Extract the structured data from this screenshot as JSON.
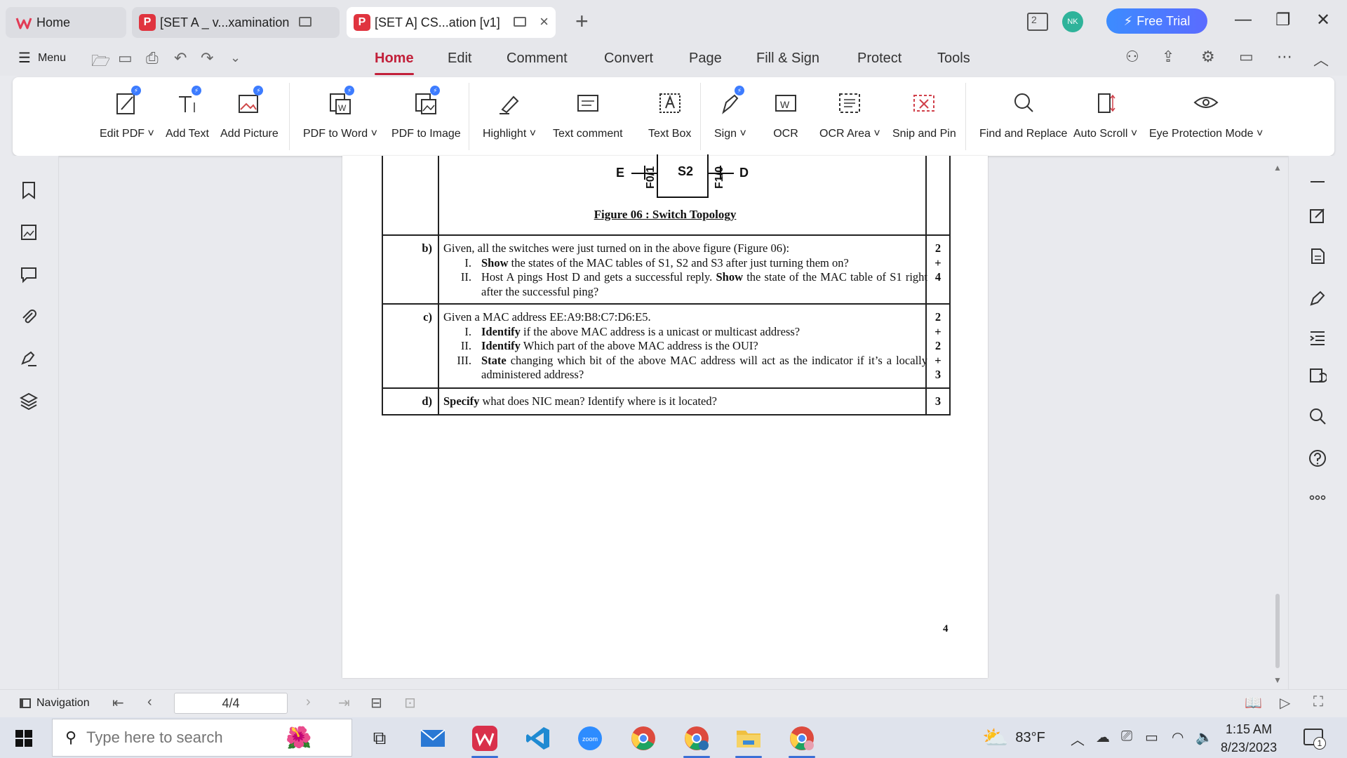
{
  "tabs": [
    {
      "label": "Home"
    },
    {
      "label": "[SET A _ v...xamination"
    },
    {
      "label": "[SET A] CS...ation [v1]"
    }
  ],
  "header": {
    "account_initials": "NK",
    "free_trial_label": "Free Trial",
    "window_count": "2"
  },
  "menubar": {
    "menu_label": "Menu",
    "tabs": [
      "Home",
      "Edit",
      "Comment",
      "Convert",
      "Page",
      "Fill & Sign",
      "Protect",
      "Tools"
    ],
    "active_tab": "Home"
  },
  "ribbon": {
    "edit_pdf": "Edit PDF",
    "add_text": "Add Text",
    "add_picture": "Add Picture",
    "pdf_to_word": "PDF to Word",
    "pdf_to_image": "PDF to Image",
    "highlight": "Highlight",
    "text_comment": "Text comment",
    "text_box": "Text Box",
    "sign": "Sign",
    "ocr": "OCR",
    "ocr_area": "OCR Area",
    "snip_and_pin": "Snip and Pin",
    "find_and_replace": "Find and Replace",
    "auto_scroll": "Auto Scroll",
    "eye_protection": "Eye Protection Mode"
  },
  "document": {
    "topology": {
      "node_left": "E",
      "switch": "S2",
      "node_right": "D",
      "port_left": "F0/1",
      "port_right": "F1/0",
      "caption": "Figure 06 : Switch Topology"
    },
    "questions": [
      {
        "letter": "b)",
        "intro": "Given, all the switches were just turned on in the above figure (Figure 06):",
        "subs": [
          {
            "num": "I.",
            "bold": "Show",
            "text": " the states of the MAC tables of S1, S2 and S3 after just turning them on?"
          },
          {
            "num": "II.",
            "pre": "Host A pings Host D and gets a successful reply. ",
            "bold": "Show",
            "text": " the state of the MAC table of S1 right after the successful ping?"
          }
        ],
        "marks": [
          "2",
          "+",
          "4"
        ]
      },
      {
        "letter": "c)",
        "intro": "Given a MAC address EE:A9:B8:C7:D6:E5.",
        "subs": [
          {
            "num": "I.",
            "bold": "Identify",
            "text": " if the above MAC address is a unicast or multicast address?"
          },
          {
            "num": "II.",
            "bold": "Identify",
            "text": " Which part of the above MAC address is the OUI?"
          },
          {
            "num": "III.",
            "bold": "State",
            "text": " changing which bit of the above MAC address will act as the indicator if it’s a locally administered address?"
          }
        ],
        "marks": [
          "2",
          "+",
          "2",
          "+",
          "3"
        ]
      },
      {
        "letter": "d)",
        "bold": "Specify",
        "text": " what does NIC mean? Identify where is it located?",
        "marks": [
          "3"
        ]
      }
    ],
    "page_number": "4"
  },
  "statusbar": {
    "navigation_label": "Navigation",
    "page_indicator": "4/4"
  },
  "taskbar": {
    "search_placeholder": "Type here to search",
    "weather": "83°F",
    "time": "1:15 AM",
    "date": "8/23/2023",
    "notification_count": "1"
  }
}
